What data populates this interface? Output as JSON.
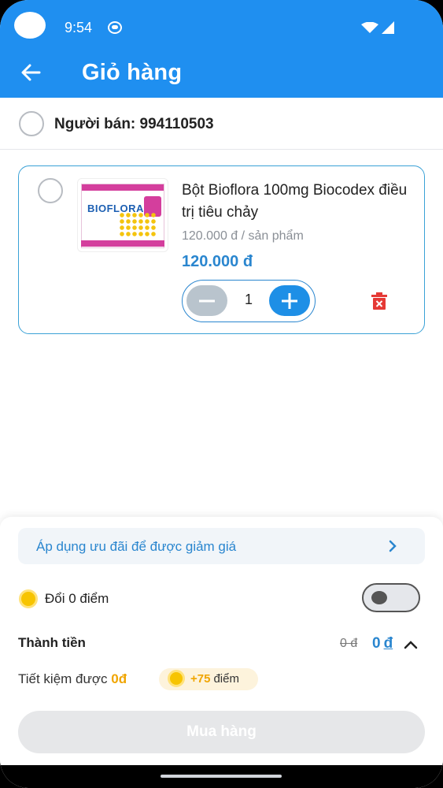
{
  "status_bar": {
    "time": "9:54"
  },
  "header": {
    "title": "Giỏ hàng",
    "back_icon": "arrow-left-icon"
  },
  "seller": {
    "label": "Người bán: 994110503"
  },
  "cart_item": {
    "name": "Bột Bioflora 100mg Biocodex điều trị tiêu chảy",
    "unit_price": "120.000 đ / sản phẩm",
    "price": "120.000 đ",
    "quantity": "1",
    "image_brand": "BIOFLORA",
    "delete_icon": "trash-icon"
  },
  "promo": {
    "text": "Áp dụng ưu đãi để được giảm giá"
  },
  "points": {
    "label": "Đổi 0 điểm",
    "toggle_on": false
  },
  "summary": {
    "total_label": "Thành tiền",
    "old_total": "0 đ",
    "new_total_value": "0",
    "new_total_currency": "đ",
    "saving_label": "Tiết kiệm được",
    "saving_amount": "0đ",
    "bonus_points": "+75",
    "bonus_unit": "điểm"
  },
  "buy_button": {
    "label": "Mua hàng",
    "enabled": false
  },
  "colors": {
    "primary": "#1f8ff0",
    "accent_blue": "#2a86cf",
    "coin": "#f7c400",
    "danger": "#e53935"
  }
}
